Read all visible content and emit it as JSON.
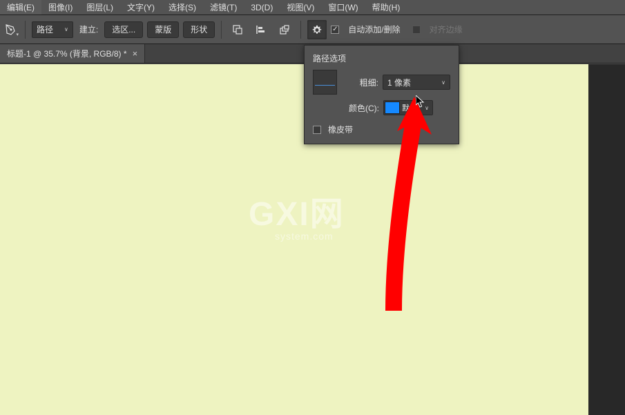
{
  "menu": {
    "items": [
      "编辑(E)",
      "图像(I)",
      "图层(L)",
      "文字(Y)",
      "选择(S)",
      "滤镜(T)",
      "3D(D)",
      "视图(V)",
      "窗口(W)",
      "帮助(H)"
    ]
  },
  "options": {
    "mode_select": "路径",
    "build_label": "建立:",
    "btn_selection": "选区...",
    "btn_mask": "蒙版",
    "btn_shape": "形状",
    "auto_add_label": "自动添加/删除",
    "align_edges_label": "对齐边缘"
  },
  "doc": {
    "tab_title": "标题-1 @ 35.7% (背景, RGB/8) *"
  },
  "popup": {
    "title": "路径选项",
    "thickness_label": "粗细:",
    "thickness_value": "1 像素",
    "color_label": "颜色(C):",
    "color_value": "默...",
    "rubber_band": "橡皮带"
  },
  "watermark": {
    "main": "GXI网",
    "sub": "system.com"
  }
}
